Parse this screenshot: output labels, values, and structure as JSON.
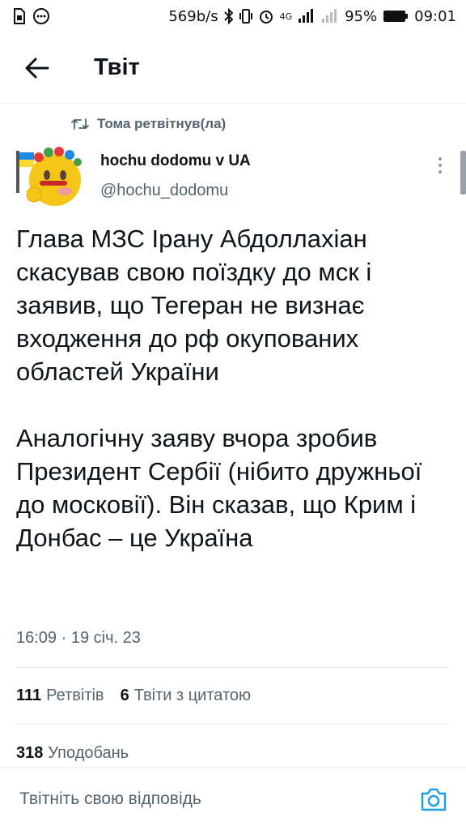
{
  "status_bar": {
    "speed": "569b/s",
    "network_label": "4G",
    "battery": "95%",
    "time": "09:01"
  },
  "header": {
    "title": "Твіт"
  },
  "retweet": {
    "text": "Тома ретвітнув(ла)"
  },
  "author": {
    "name": "hochu dodomu v UA",
    "handle": "@hochu_dodomu"
  },
  "tweet": {
    "text": "Глава МЗС Ірану Абдоллахіан скасував свою поїздку до мск і заявив, що Тегеран не визнає входження до рф окупованих областей України\n\nАналогічну заяву вчора зробив Президент Сербії (нібито дружньої до московії). Він сказав, що Крим і Донбас – це Україна",
    "timestamp": "16:09 · 19 січ. 23"
  },
  "stats": {
    "retweets_count": "111",
    "retweets_label": "Ретвітів",
    "quotes_count": "6",
    "quotes_label": "Твіти з цитатою",
    "likes_count": "318",
    "likes_label": "Уподобань"
  },
  "reply": {
    "placeholder": "Твітніть свою відповідь"
  },
  "colors": {
    "accent": "#1d9bf0",
    "text_primary": "#0f1419",
    "text_secondary": "#536471"
  },
  "icons": {
    "back": "arrow-left-icon",
    "retweet": "retweet-icon",
    "more": "more-vertical-icon",
    "camera": "camera-icon"
  }
}
